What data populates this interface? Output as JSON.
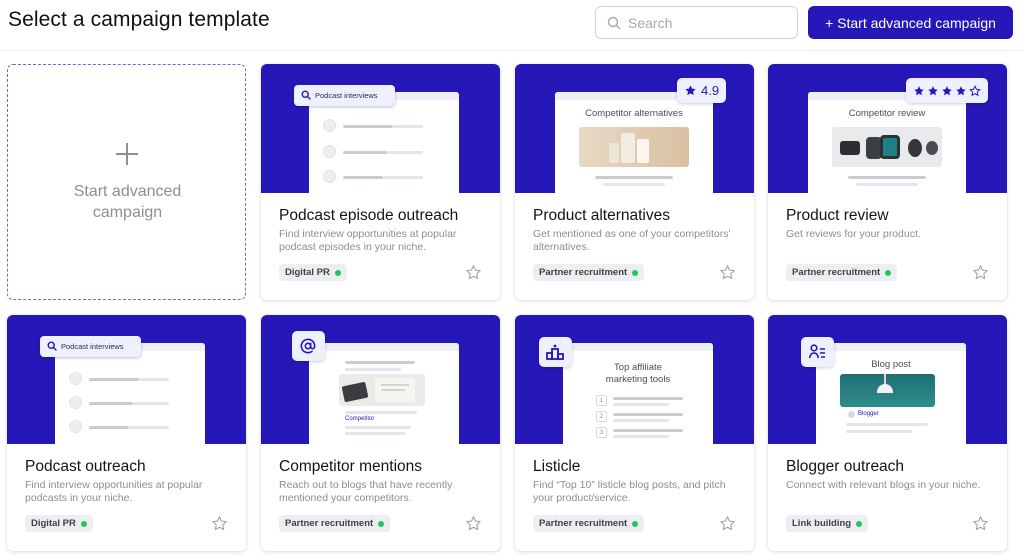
{
  "header": {
    "title": "Select a campaign template",
    "search_placeholder": "Search",
    "start_button_label": "+ Start advanced campaign"
  },
  "advanced_card": {
    "label_line1": "Start advanced",
    "label_line2": "campaign"
  },
  "cards": [
    {
      "title": "Podcast episode outreach",
      "description": "Find interview opportunities at popular podcast episodes in your niche.",
      "tag": "Digital PR",
      "thumb_chip": "Podcast interviews"
    },
    {
      "title": "Product alternatives",
      "description": "Get mentioned as one of your competitors' alternatives.",
      "tag": "Partner recruitment",
      "thumb_title": "Competitor alternatives",
      "rating": "4.9"
    },
    {
      "title": "Product review",
      "description": "Get reviews for your product.",
      "tag": "Partner recruitment",
      "thumb_title": "Competitor review",
      "stars": 4,
      "stars_total": 5
    },
    {
      "title": "Podcast outreach",
      "description": "Find interview opportunities at popular podcasts in your niche.",
      "tag": "Digital PR",
      "thumb_chip": "Podcast interviews"
    },
    {
      "title": "Competitor mentions",
      "description": "Reach out to blogs that have recently mentioned your competitors.",
      "tag": "Partner recruitment",
      "thumb_link": "Competitor"
    },
    {
      "title": "Listicle",
      "description": "Find “Top 10” listicle blog posts, and pitch your product/service.",
      "tag": "Partner recruitment",
      "thumb_title_line1": "Top affiliate",
      "thumb_title_line2": "marketing tools",
      "thumb_numbers": [
        "1",
        "2",
        "3"
      ]
    },
    {
      "title": "Blogger outreach",
      "description": "Connect with relevant blogs in your niche.",
      "tag": "Link building",
      "thumb_title": "Blog post",
      "thumb_author": "Blogger"
    }
  ],
  "colors": {
    "accent": "#2617b8",
    "tag_dot": "#22c55e",
    "chip_bg": "#eef0ff"
  },
  "icons": {
    "search": "search-icon",
    "plus": "plus-icon",
    "favorite": "star-outline-icon",
    "rating": "star-filled-icon",
    "at": "at-sign-icon",
    "listicle": "podium-icon",
    "blogger": "user-list-icon"
  }
}
